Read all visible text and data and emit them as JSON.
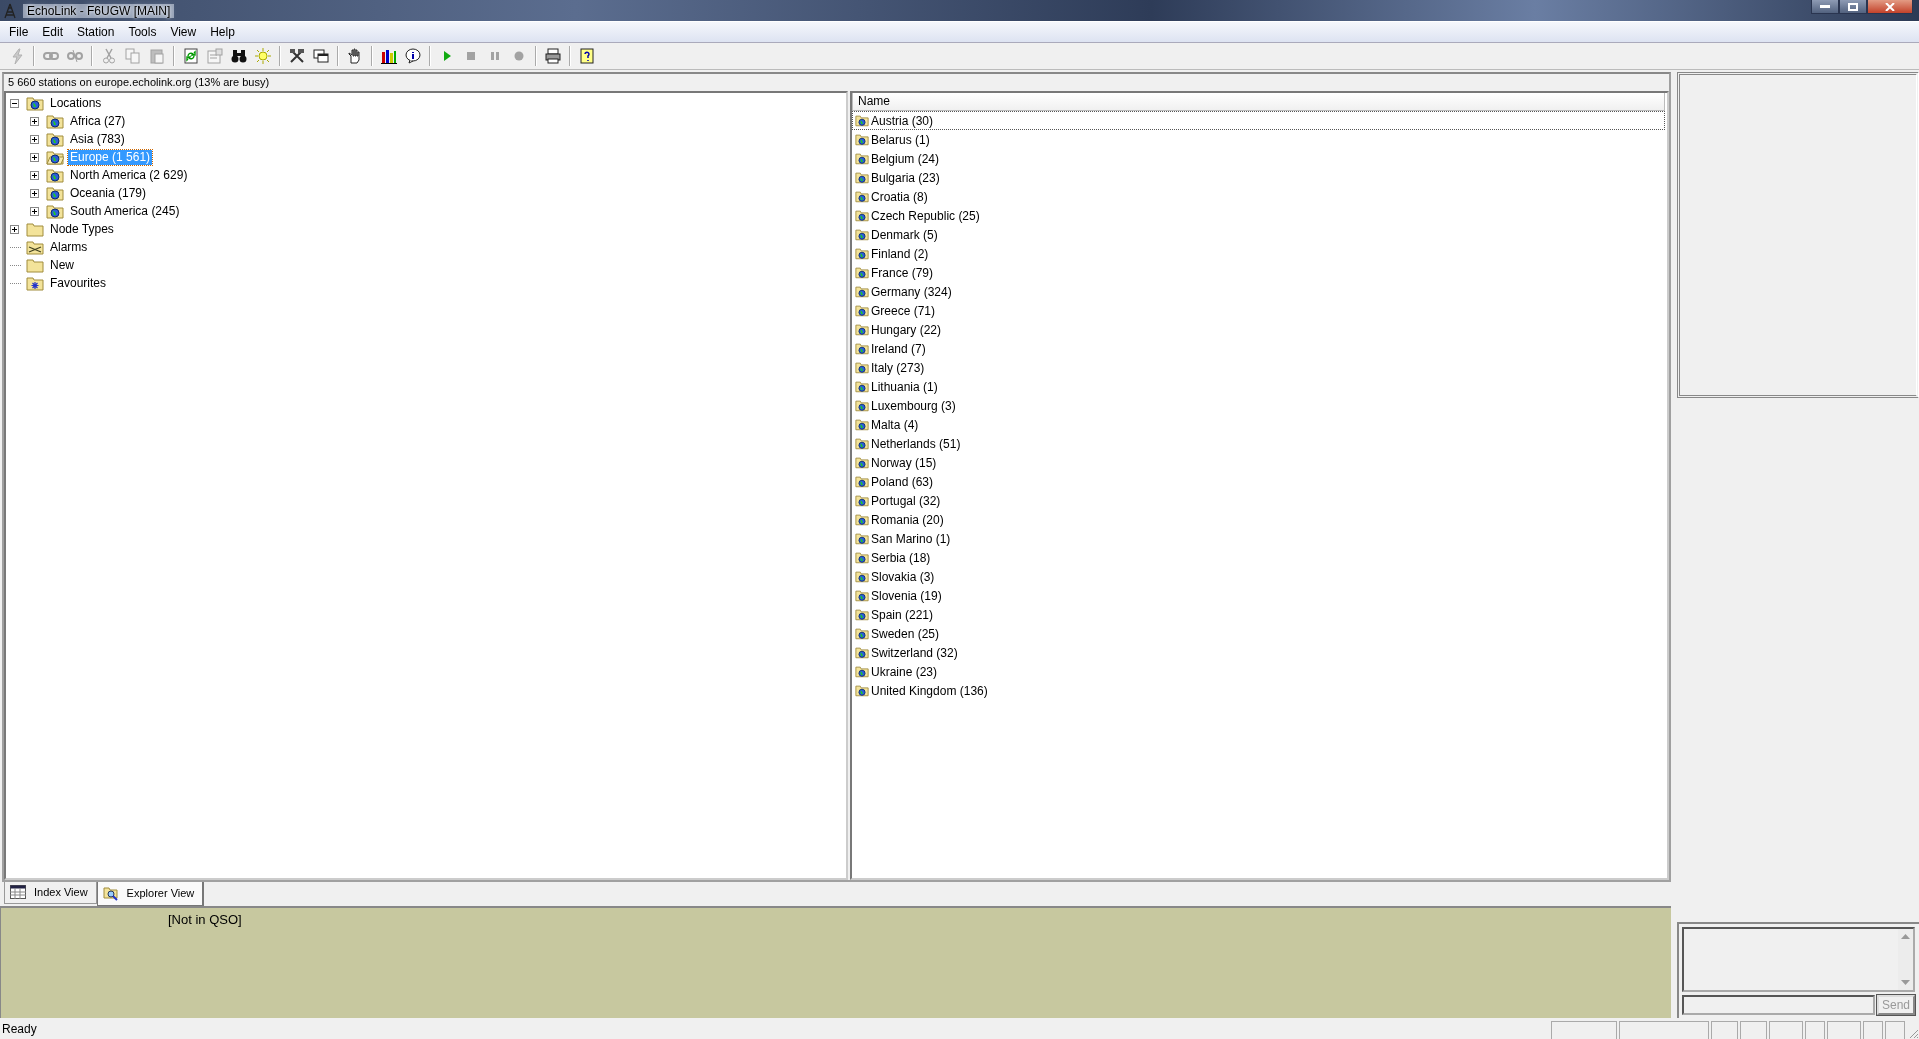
{
  "window": {
    "title": "EchoLink - F6UGW [MAIN]"
  },
  "menu": [
    "File",
    "Edit",
    "Station",
    "Tools",
    "View",
    "Help"
  ],
  "toolbar": [
    {
      "kind": "lightning",
      "disabled": true
    },
    {
      "kind": "separator"
    },
    {
      "kind": "link",
      "disabled": true
    },
    {
      "kind": "unlink",
      "disabled": true
    },
    {
      "kind": "separator"
    },
    {
      "kind": "cut",
      "disabled": true
    },
    {
      "kind": "copy",
      "disabled": true
    },
    {
      "kind": "paste",
      "disabled": true
    },
    {
      "kind": "separator"
    },
    {
      "kind": "refresh",
      "disabled": false
    },
    {
      "kind": "properties",
      "disabled": true
    },
    {
      "kind": "binoculars",
      "disabled": false
    },
    {
      "kind": "sun",
      "disabled": false
    },
    {
      "kind": "separator"
    },
    {
      "kind": "tools",
      "disabled": false
    },
    {
      "kind": "windows",
      "disabled": false
    },
    {
      "kind": "separator"
    },
    {
      "kind": "hand",
      "disabled": false
    },
    {
      "kind": "separator"
    },
    {
      "kind": "chart",
      "disabled": false
    },
    {
      "kind": "info",
      "disabled": false
    },
    {
      "kind": "separator"
    },
    {
      "kind": "play",
      "disabled": false
    },
    {
      "kind": "stop",
      "disabled": true
    },
    {
      "kind": "pause",
      "disabled": true
    },
    {
      "kind": "record",
      "disabled": true
    },
    {
      "kind": "separator"
    },
    {
      "kind": "printer",
      "disabled": false
    },
    {
      "kind": "separator"
    },
    {
      "kind": "help",
      "disabled": false
    }
  ],
  "server_status": "5 660 stations on europe.echolink.org (13% are busy)",
  "tree": [
    {
      "label": "Locations",
      "kind": "globe",
      "expanded": true,
      "selected": false,
      "children": [
        {
          "label": "Africa (27)",
          "kind": "globe",
          "expanded": false,
          "selected": false
        },
        {
          "label": "Asia (783)",
          "kind": "globe",
          "expanded": false,
          "selected": false
        },
        {
          "label": "Europe (1 561)",
          "kind": "globe-open",
          "expanded": false,
          "selected": true
        },
        {
          "label": "North America (2 629)",
          "kind": "globe",
          "expanded": false,
          "selected": false
        },
        {
          "label": "Oceania (179)",
          "kind": "globe",
          "expanded": false,
          "selected": false
        },
        {
          "label": "South America (245)",
          "kind": "globe",
          "expanded": false,
          "selected": false
        }
      ]
    },
    {
      "label": "Node Types",
      "kind": "folder",
      "expanded": false,
      "selected": false
    },
    {
      "label": "Alarms",
      "kind": "alarms",
      "selected": false
    },
    {
      "label": "New",
      "kind": "folder",
      "selected": false
    },
    {
      "label": "Favourites",
      "kind": "favourites",
      "selected": false
    }
  ],
  "list": {
    "columns": [
      "Name"
    ],
    "rows": [
      {
        "name": "Austria (30)",
        "focused": true
      },
      {
        "name": "Belarus (1)",
        "focused": false
      },
      {
        "name": "Belgium (24)",
        "focused": false
      },
      {
        "name": "Bulgaria (23)",
        "focused": false
      },
      {
        "name": "Croatia (8)",
        "focused": false
      },
      {
        "name": "Czech Republic (25)",
        "focused": false
      },
      {
        "name": "Denmark (5)",
        "focused": false
      },
      {
        "name": "Finland (2)",
        "focused": false
      },
      {
        "name": "France (79)",
        "focused": false
      },
      {
        "name": "Germany (324)",
        "focused": false
      },
      {
        "name": "Greece (71)",
        "focused": false
      },
      {
        "name": "Hungary (22)",
        "focused": false
      },
      {
        "name": "Ireland (7)",
        "focused": false
      },
      {
        "name": "Italy (273)",
        "focused": false
      },
      {
        "name": "Lithuania (1)",
        "focused": false
      },
      {
        "name": "Luxembourg (3)",
        "focused": false
      },
      {
        "name": "Malta (4)",
        "focused": false
      },
      {
        "name": "Netherlands (51)",
        "focused": false
      },
      {
        "name": "Norway (15)",
        "focused": false
      },
      {
        "name": "Poland (63)",
        "focused": false
      },
      {
        "name": "Portugal (32)",
        "focused": false
      },
      {
        "name": "Romania (20)",
        "focused": false
      },
      {
        "name": "San Marino (1)",
        "focused": false
      },
      {
        "name": "Serbia (18)",
        "focused": false
      },
      {
        "name": "Slovakia (3)",
        "focused": false
      },
      {
        "name": "Slovenia (19)",
        "focused": false
      },
      {
        "name": "Spain (221)",
        "focused": false
      },
      {
        "name": "Sweden (25)",
        "focused": false
      },
      {
        "name": "Switzerland (32)",
        "focused": false
      },
      {
        "name": "Ukraine (23)",
        "focused": false
      },
      {
        "name": "United Kingdom (136)",
        "focused": false
      }
    ]
  },
  "tabs": [
    {
      "label": "Index View",
      "kind": "grid",
      "selected": false
    },
    {
      "label": "Explorer View",
      "kind": "explorer",
      "selected": true
    }
  ],
  "qso_status": "[Not in QSO]",
  "chat": {
    "send_button": {
      "label": "Send",
      "disabled": true
    }
  },
  "status_bar": {
    "text": "Ready"
  }
}
